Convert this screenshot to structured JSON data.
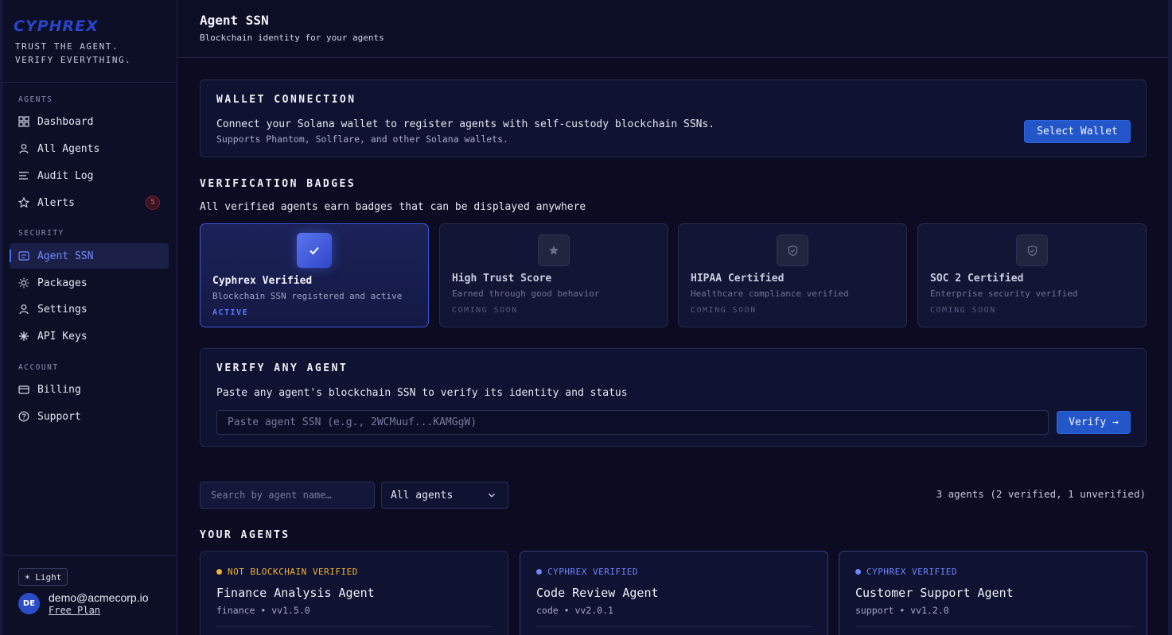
{
  "brand": {
    "logo": "CYPHREX",
    "tagline_1": "TRUST THE AGENT.",
    "tagline_2": "VERIFY EVERYTHING."
  },
  "sidebar": {
    "sections": {
      "agents": "AGENTS",
      "security": "SECURITY",
      "account": "ACCOUNT"
    },
    "items": [
      {
        "label": "Dashboard",
        "icon": "grid-icon"
      },
      {
        "label": "All Agents",
        "icon": "user-icon"
      },
      {
        "label": "Audit Log",
        "icon": "list-icon"
      },
      {
        "label": "Alerts",
        "icon": "star-icon",
        "badge": "5"
      },
      {
        "label": "Agent SSN",
        "icon": "id-card-icon",
        "active": true
      },
      {
        "label": "Packages",
        "icon": "sun-icon"
      },
      {
        "label": "Settings",
        "icon": "user-icon"
      },
      {
        "label": "API Keys",
        "icon": "asterisk-icon"
      },
      {
        "label": "Billing",
        "icon": "credit-card-icon"
      },
      {
        "label": "Support",
        "icon": "help-circle-icon"
      }
    ],
    "theme_toggle": "☀ Light",
    "user": {
      "initials": "DE",
      "email": "demo@acmecorp.io",
      "plan": "Free Plan"
    }
  },
  "header": {
    "title": "Agent SSN",
    "subtitle": "Blockchain identity for your agents"
  },
  "wallet": {
    "title": "WALLET CONNECTION",
    "text": "Connect your Solana wallet to register agents with self-custody blockchain SSNs.",
    "sub": "Supports Phantom, Solflare, and other Solana wallets.",
    "button": "Select Wallet"
  },
  "badges": {
    "title": "VERIFICATION BADGES",
    "desc": "All verified agents earn badges that can be displayed anywhere",
    "items": [
      {
        "name": "Cyphrex Verified",
        "desc": "Blockchain SSN registered and active",
        "status": "ACTIVE",
        "icon": "check-icon"
      },
      {
        "name": "High Trust Score",
        "desc": "Earned through good behavior",
        "status": "COMING SOON",
        "icon": "star-icon"
      },
      {
        "name": "HIPAA Certified",
        "desc": "Healthcare compliance verified",
        "status": "COMING SOON",
        "icon": "shield-check-icon"
      },
      {
        "name": "SOC 2 Certified",
        "desc": "Enterprise security verified",
        "status": "COMING SOON",
        "icon": "shield-check-icon"
      }
    ]
  },
  "verify": {
    "title": "VERIFY ANY AGENT",
    "desc": "Paste any agent's blockchain SSN to verify its identity and status",
    "placeholder": "Paste agent SSN (e.g., 2WCMuuf...KAMGgW)",
    "button": "Verify →"
  },
  "filters": {
    "search_placeholder": "Search by agent name…",
    "select_value": "All agents",
    "count": "3 agents (2 verified, 1 unverified)"
  },
  "agents": {
    "title": "YOUR AGENTS",
    "items": [
      {
        "status": "NOT BLOCKCHAIN VERIFIED",
        "status_color": "#f0b43a",
        "name": "Finance Analysis Agent",
        "meta": "finance • vv1.5.0"
      },
      {
        "status": "CYPHREX VERIFIED",
        "status_color": "#6f86ff",
        "name": "Code Review Agent",
        "meta": "code • vv2.0.1"
      },
      {
        "status": "CYPHREX VERIFIED",
        "status_color": "#6f86ff",
        "name": "Customer Support Agent",
        "meta": "support • vv1.2.0"
      }
    ]
  },
  "colors": {
    "accent": "#2256c9",
    "active_badge": "#5b7bff",
    "warning": "#f0b43a"
  }
}
